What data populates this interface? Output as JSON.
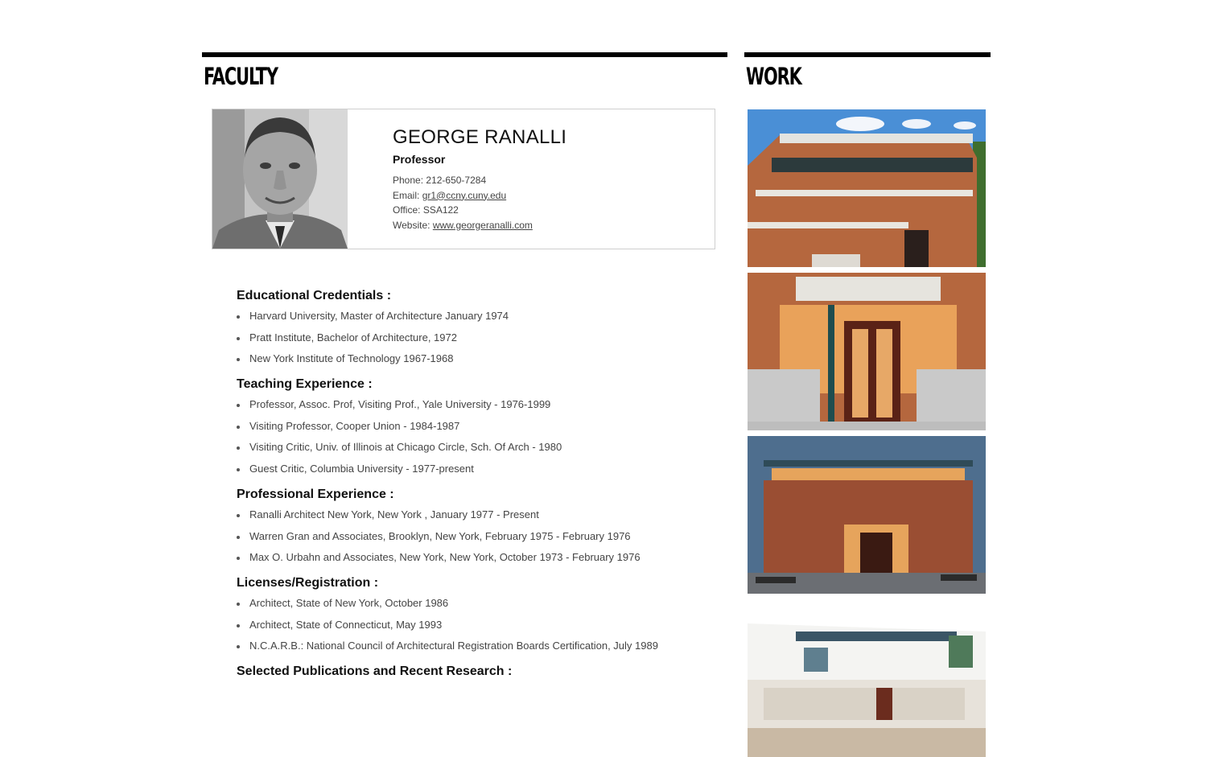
{
  "faculty": {
    "heading": "FACULTY",
    "profile": {
      "name": "GEORGE RANALLI",
      "title": "Professor",
      "phone_label": "Phone:",
      "phone": "212-650-7284",
      "email_label": "Email:",
      "email": "gr1@ccny.cuny.edu",
      "office_label": "Office:",
      "office": "SSA122",
      "website_label": "Website:",
      "website": "www.georgeranalli.com"
    },
    "sections": [
      {
        "heading": "Educational Credentials :",
        "items": [
          "Harvard University, Master of Architecture January 1974",
          "Pratt Institute, Bachelor of Architecture, 1972",
          "New York Institute of Technology 1967-1968"
        ]
      },
      {
        "heading": "Teaching Experience :",
        "items": [
          "Professor, Assoc. Prof, Visiting Prof., Yale University - 1976-1999",
          "Visiting Professor, Cooper Union - 1984-1987",
          "Visiting Critic, Univ. of Illinois at Chicago Circle, Sch. Of Arch - 1980",
          "Guest Critic, Columbia University - 1977-present"
        ]
      },
      {
        "heading": "Professional Experience :",
        "items": [
          "Ranalli Architect New York, New York , January 1977 - Present",
          "Warren Gran and Associates, Brooklyn, New York, February 1975 - February 1976",
          "Max O. Urbahn and Associates, New York, New York, October 1973 - February 1976"
        ]
      },
      {
        "heading": "Licenses/Registration :",
        "items": [
          "Architect, State of New York, October 1986",
          "Architect, State of Connecticut, May 1993",
          "N.C.A.R.B.: National Council of Architectural Registration Boards Certification, July 1989"
        ]
      },
      {
        "heading": "Selected Publications and Recent Research :",
        "items": []
      }
    ]
  },
  "work": {
    "heading": "WORK",
    "thumbnails": [
      {
        "name": "brick-building-exterior-sky"
      },
      {
        "name": "entrance-doors"
      },
      {
        "name": "building-at-dusk"
      },
      {
        "name": "interior-hall"
      }
    ]
  },
  "colors": {
    "rule": "#000000",
    "brick": "#b5673e",
    "sky": "#4a8fd6"
  }
}
